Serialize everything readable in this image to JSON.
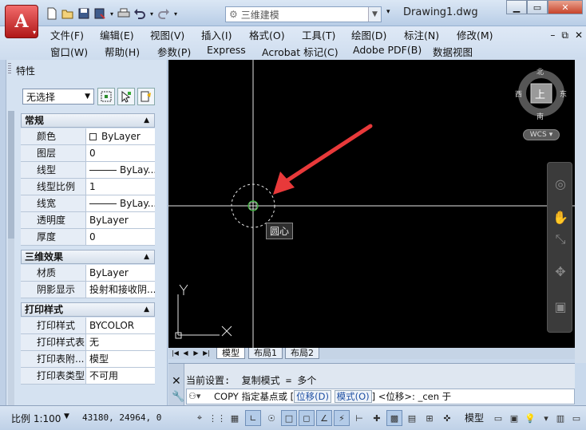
{
  "app": {
    "doc_title": "Drawing1.dwg",
    "workspace": "三维建模",
    "icons": [
      "new-icon",
      "open-icon",
      "save-icon",
      "saveas-icon",
      "plot-icon",
      "undo-icon",
      "redo-icon"
    ]
  },
  "menu": {
    "row1": [
      "文件(F)",
      "编辑(E)",
      "视图(V)",
      "插入(I)",
      "格式(O)",
      "工具(T)",
      "绘图(D)",
      "标注(N)",
      "修改(M)"
    ],
    "row2": [
      "窗口(W)",
      "帮助(H)",
      "参数(P)",
      "Express",
      "Acrobat 标记(C)",
      "Adobe PDF(B)",
      "数据视图"
    ]
  },
  "properties": {
    "title": "特性",
    "selection": "无选择",
    "sections": [
      {
        "name": "常规",
        "rows": [
          {
            "k": "颜色",
            "v": "ByLayer",
            "swatch": true
          },
          {
            "k": "图层",
            "v": "0"
          },
          {
            "k": "线型",
            "v": "ByLay...",
            "line": true
          },
          {
            "k": "线型比例",
            "v": "1"
          },
          {
            "k": "线宽",
            "v": "ByLay...",
            "line": true
          },
          {
            "k": "透明度",
            "v": "ByLayer"
          },
          {
            "k": "厚度",
            "v": "0"
          }
        ]
      },
      {
        "name": "三维效果",
        "rows": [
          {
            "k": "材质",
            "v": "ByLayer"
          },
          {
            "k": "阴影显示",
            "v": "投射和接收阴..."
          }
        ]
      },
      {
        "name": "打印样式",
        "rows": [
          {
            "k": "打印样式",
            "v": "BYCOLOR"
          },
          {
            "k": "打印样式表",
            "v": "无"
          },
          {
            "k": "打印表附...",
            "v": "模型"
          },
          {
            "k": "打印表类型",
            "v": "不可用"
          }
        ]
      }
    ]
  },
  "canvas": {
    "osnap_tooltip": "圆心",
    "viewcube": {
      "top": "上",
      "north": "北",
      "south": "南",
      "east": "东",
      "west": "西"
    },
    "wcs": "WCS",
    "ucs_x": "X",
    "ucs_y": "Y"
  },
  "layout_tabs": [
    "模型",
    "布局1",
    "布局2"
  ],
  "command": {
    "history": "当前设置:  复制模式 = 多个",
    "prompt_cmd": "COPY",
    "prompt_text": "指定基点或",
    "opt1": "位移(D)",
    "opt2": "模式(O)",
    "tail": "<位移>:  _cen 于"
  },
  "status": {
    "scale": "比例 1:100",
    "coords": "43180, 24964, 0",
    "model": "模型"
  }
}
